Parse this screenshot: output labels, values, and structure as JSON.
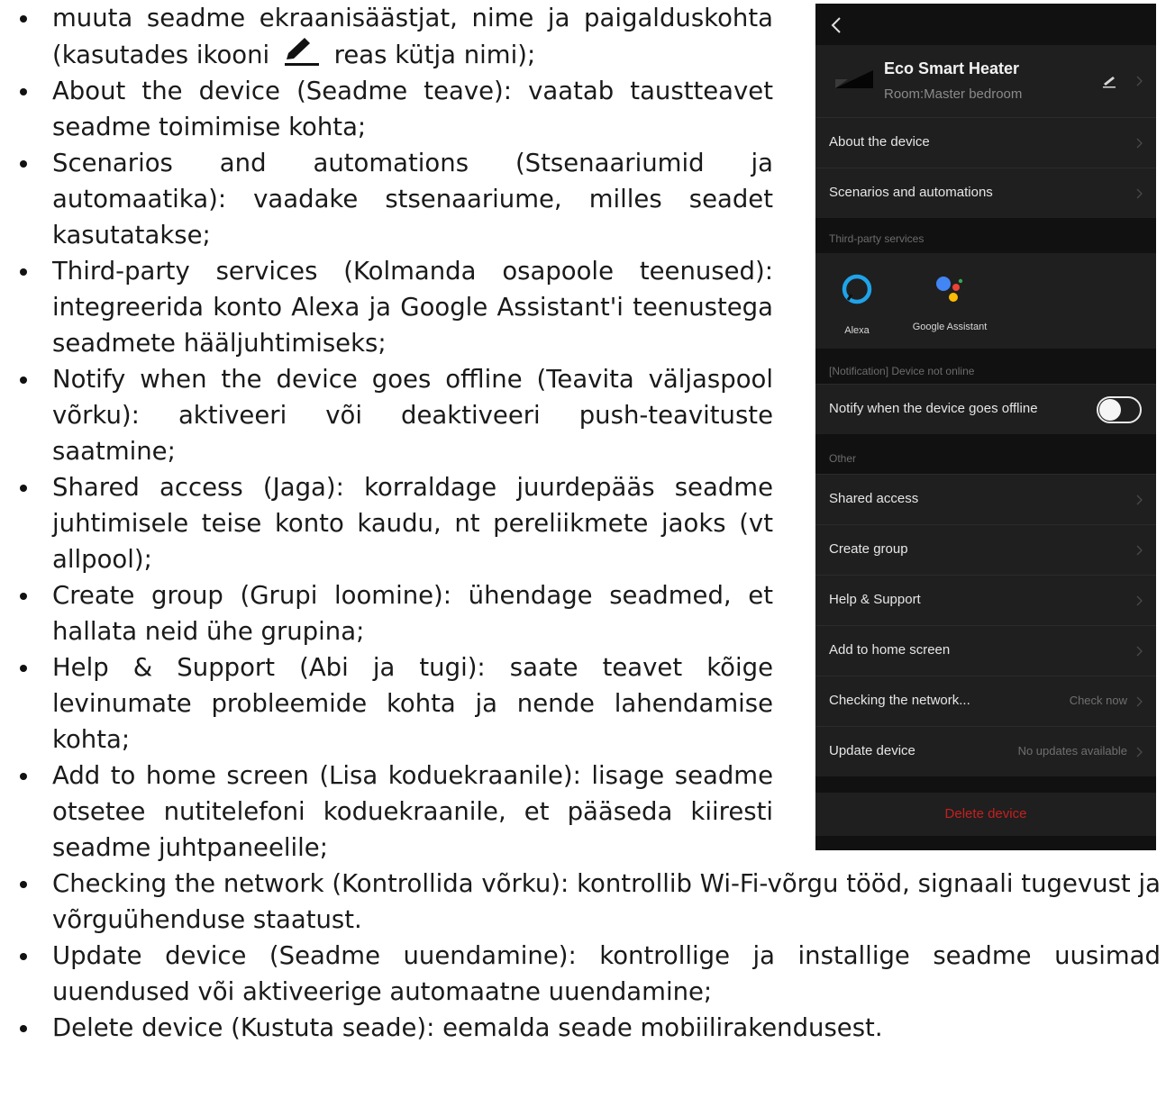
{
  "bullets": [
    {
      "pre": "muuta seadme ekraanisäästjat, nime ja paigalduskohta (kasutades ikooni",
      "post": "reas kütja nimi);"
    },
    {
      "text": "About the device (Seadme teave): vaatab taustteavet seadme toimimise kohta;"
    },
    {
      "text": "Scenarios and automations (Stsenaariumid ja automaatika): vaadake stsenaariume, milles seadet kasutatakse;"
    },
    {
      "text": "Third-party services (Kolmanda osapoole teenused): integreerida konto Alexa ja Google Assistant'i teenustega seadmete hääljuhtimiseks;"
    },
    {
      "text": "Notify when the device goes offline (Teavita väljaspool võrku): aktiveeri või deaktiveeri push-teavituste saatmine;"
    },
    {
      "text": "Shared access (Jaga): korraldage juurdepääs seadme juhtimisele teise konto kaudu, nt pereliikmete jaoks (vt allpool);"
    },
    {
      "text": "Create group (Grupi loomine): ühendage seadmed, et hallata neid ühe grupina;"
    },
    {
      "text": "Help & Support (Abi ja tugi): saate teavet kõige levinumate probleemide kohta ja nende lahendamise kohta;"
    },
    {
      "text": "Add to home screen (Lisa koduekraanile): lisage seadme otsetee nutitelefoni koduekraanile, et pääseda kiiresti seadme juhtpaneelile;"
    },
    {
      "text": "Checking the network (Kontrollida võrku): kontrollib Wi-Fi-võrgu tööd, signaali tugevust ja võrguühenduse staatust."
    },
    {
      "text": "Update device (Seadme uuendamine): kontrollige ja installige seadme uusimad uuendused või aktiveerige automaatne uuendamine;"
    },
    {
      "text": "Delete device (Kustuta seade): eemalda seade mobiilirakendusest."
    }
  ],
  "phone": {
    "device_name": "Eco Smart Heater",
    "room": "Room:Master bedroom",
    "about": "About the device",
    "scenarios": "Scenarios and automations",
    "third_party_header": "Third-party services",
    "services": [
      {
        "name": "Alexa"
      },
      {
        "name": "Google Assistant"
      }
    ],
    "notification_header": "[Notification] Device not online",
    "notify_label": "Notify when the device goes offline",
    "notify_enabled": false,
    "other_header": "Other",
    "shared_access": "Shared access",
    "create_group": "Create group",
    "help_support": "Help & Support",
    "add_home": "Add to home screen",
    "checking_network": "Checking the network...",
    "check_now": "Check now",
    "update_device": "Update device",
    "no_updates": "No updates available",
    "delete_device": "Delete device",
    "colors": {
      "background": "#111111",
      "row": "#1f1f1f",
      "delete": "#c42020"
    }
  }
}
